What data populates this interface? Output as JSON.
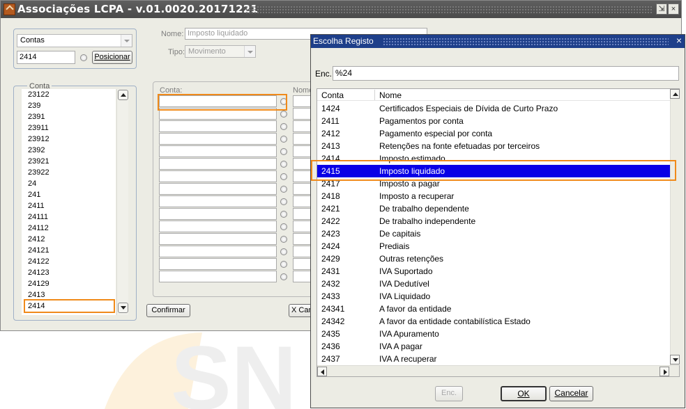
{
  "main_window": {
    "title": "Associações LCPA - v.01.0020.20171221",
    "buttons": {
      "restore": "⇲",
      "close": "×"
    },
    "filter": {
      "type_value": "Contas",
      "conta_value": "2414",
      "posicionar_label": "Posicionar"
    },
    "nome_label": "Nome:",
    "nome_value": "Imposto liquidado",
    "tipo_label": "Tipo:",
    "tipo_value": "Movimento",
    "conta_group_label": "Conta",
    "conta_list": [
      "23122",
      "239",
      "2391",
      "23911",
      "23912",
      "2392",
      "23921",
      "23922",
      "24",
      "241",
      "2411",
      "24111",
      "24112",
      "2412",
      "24121",
      "24122",
      "24123",
      "24129",
      "2413",
      "2414"
    ],
    "grid_conta_label": "Conta:",
    "grid_nome_label": "Nome",
    "confirmar_label": "Confirmar",
    "cancelar_partial": "X Can"
  },
  "dialog": {
    "title": "Escolha Registo",
    "close": "×",
    "enc_label": "Enc.",
    "enc_value": "%24",
    "columns": [
      "Conta",
      "Nome"
    ],
    "rows": [
      {
        "conta": "1424",
        "nome": "Certificados Especiais de Dívida de Curto Prazo"
      },
      {
        "conta": "2411",
        "nome": "Pagamentos por conta"
      },
      {
        "conta": "2412",
        "nome": "Pagamento especial por conta"
      },
      {
        "conta": "2413",
        "nome": "Retenções na fonte efetuadas por terceiros"
      },
      {
        "conta": "2414",
        "nome": "Imposto estimado"
      },
      {
        "conta": "2415",
        "nome": "Imposto liquidado"
      },
      {
        "conta": "2417",
        "nome": "Imposto a pagar"
      },
      {
        "conta": "2418",
        "nome": "Imposto a recuperar"
      },
      {
        "conta": "2421",
        "nome": "De trabalho dependente"
      },
      {
        "conta": "2422",
        "nome": "De trabalho independente"
      },
      {
        "conta": "2423",
        "nome": "De capitais"
      },
      {
        "conta": "2424",
        "nome": "Prediais"
      },
      {
        "conta": "2429",
        "nome": "Outras retenções"
      },
      {
        "conta": "2431",
        "nome": "IVA Suportado"
      },
      {
        "conta": "2432",
        "nome": "IVA Dedutível"
      },
      {
        "conta": "2433",
        "nome": "IVA Liquidado"
      },
      {
        "conta": "24341",
        "nome": "A favor da entidade"
      },
      {
        "conta": "24342",
        "nome": "A favor da entidade contabilística Estado"
      },
      {
        "conta": "2435",
        "nome": "IVA Apuramento"
      },
      {
        "conta": "2436",
        "nome": "IVA A pagar"
      },
      {
        "conta": "2437",
        "nome": "IVA A recuperar"
      }
    ],
    "selected_conta": "2415",
    "buttons": {
      "enc": "Enc.",
      "ok": "OK",
      "cancelar": "Cancelar"
    }
  },
  "colors": {
    "selection": "#0a00e6",
    "highlight_outline": "#f08a1a",
    "dialog_title": "#1e3f8a"
  }
}
